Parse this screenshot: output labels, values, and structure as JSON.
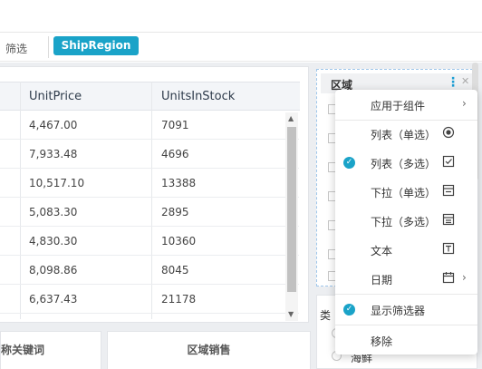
{
  "filter_bar": {
    "label": "筛选",
    "active_filter": "ShipRegion"
  },
  "table": {
    "columns": [
      "UnitPrice",
      "UnitsInStock"
    ],
    "rows": [
      {
        "unit_price": "4,467.00",
        "units_in_stock": "7091"
      },
      {
        "unit_price": "7,933.48",
        "units_in_stock": "4696"
      },
      {
        "unit_price": "10,517.10",
        "units_in_stock": "13388"
      },
      {
        "unit_price": "5,083.30",
        "units_in_stock": "2895"
      },
      {
        "unit_price": "4,830.30",
        "units_in_stock": "10360"
      },
      {
        "unit_price": "8,098.86",
        "units_in_stock": "8045"
      },
      {
        "unit_price": "6,637.43",
        "units_in_stock": "21178"
      }
    ]
  },
  "bottom_cards": {
    "left_title": "称关键词",
    "right_title": "区域销售"
  },
  "region_panel": {
    "title": "区域"
  },
  "right_panel": {
    "edge_text": "类",
    "last_option": "海鲜"
  },
  "context_menu": {
    "apply_to": "应用于组件",
    "list_single": "列表（单选）",
    "list_multi": "列表（多选）",
    "dropdown_single": "下拉（单选）",
    "dropdown_multi": "下拉（多选）",
    "text": "文本",
    "date": "日期",
    "show_filter": "显示筛选器",
    "remove": "移除"
  },
  "colors": {
    "accent": "#1aa3c8"
  }
}
